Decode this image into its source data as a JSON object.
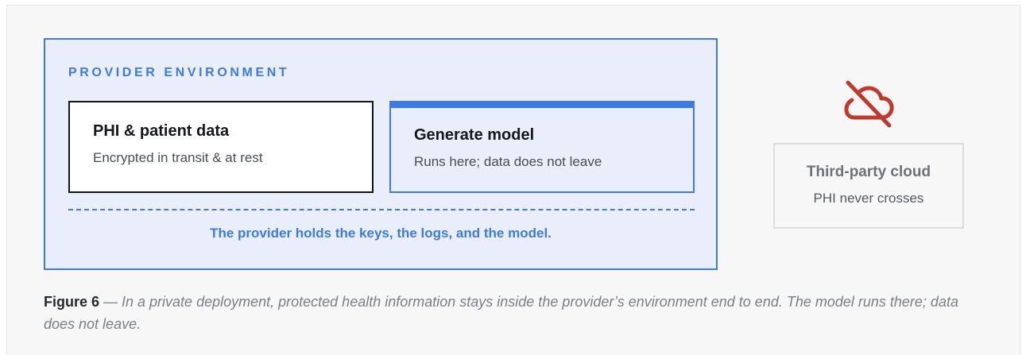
{
  "environment": {
    "label": "PROVIDER ENVIRONMENT",
    "phi_box": {
      "title": "PHI & patient data",
      "subtitle": "Encrypted in transit & at rest"
    },
    "model_box": {
      "title": "Generate model",
      "subtitle": "Runs here; data does not leave"
    },
    "note": "The provider holds the keys, the logs, and the model."
  },
  "third_party": {
    "icon": "cloud-off-icon",
    "title": "Third-party cloud",
    "subtitle": "PHI never crosses"
  },
  "caption": {
    "label": "Figure 6",
    "text": " — In a private deployment, protected health information stays inside the provider’s environment end to end. The model runs there; data does not leave."
  },
  "colors": {
    "accent": "#3b7be3",
    "environment_fill": "#e9eefa",
    "warning": "#c0392b"
  }
}
